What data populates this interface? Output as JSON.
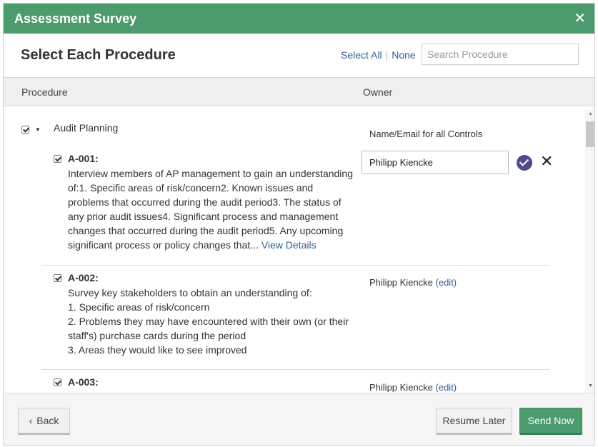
{
  "modal": {
    "title": "Assessment Survey",
    "heading": "Select Each Procedure",
    "select_all": "Select All",
    "none": "None",
    "search_placeholder": "Search Procedure"
  },
  "columns": {
    "procedure": "Procedure",
    "owner": "Owner"
  },
  "group": {
    "label": "Audit Planning",
    "owner_label": "Name/Email for all Controls",
    "checked": true
  },
  "procedures": [
    {
      "id": "A-001:",
      "text": "Interview members of AP management to gain an understanding of:1. Specific areas of risk/concern2. Known issues and problems that occurred during the audit period3. The status of any prior audit issues4. Significant process and management changes that occurred during the audit period5. Any upcoming significant process or policy changes that...",
      "link": "View Details",
      "owner_input_value": "Philipp Kiencke",
      "checked": true
    },
    {
      "id": "A-002:",
      "lines": [
        "Survey key stakeholders to obtain an understanding of:",
        "1. Specific areas of risk/concern",
        "2. Problems they may have encountered with their own (or their staff's) purchase cards during the period",
        "3. Areas they would like to see improved"
      ],
      "owner": "Philipp Kiencke",
      "edit": "(edit)",
      "checked": true
    },
    {
      "id": "A-003:",
      "owner": "Philipp Kiencke",
      "edit": "(edit)",
      "checked": true
    }
  ],
  "footer": {
    "back": "Back",
    "resume": "Resume Later",
    "send": "Send Now"
  },
  "icons": {
    "close": "close-icon",
    "confirm": "check-circle-icon",
    "cancel": "x-icon",
    "back": "chevron-left-icon"
  },
  "colors": {
    "header_green": "#4c9b6c",
    "link_blue": "#2f5f93",
    "confirm_purple": "#4e4b8c"
  }
}
